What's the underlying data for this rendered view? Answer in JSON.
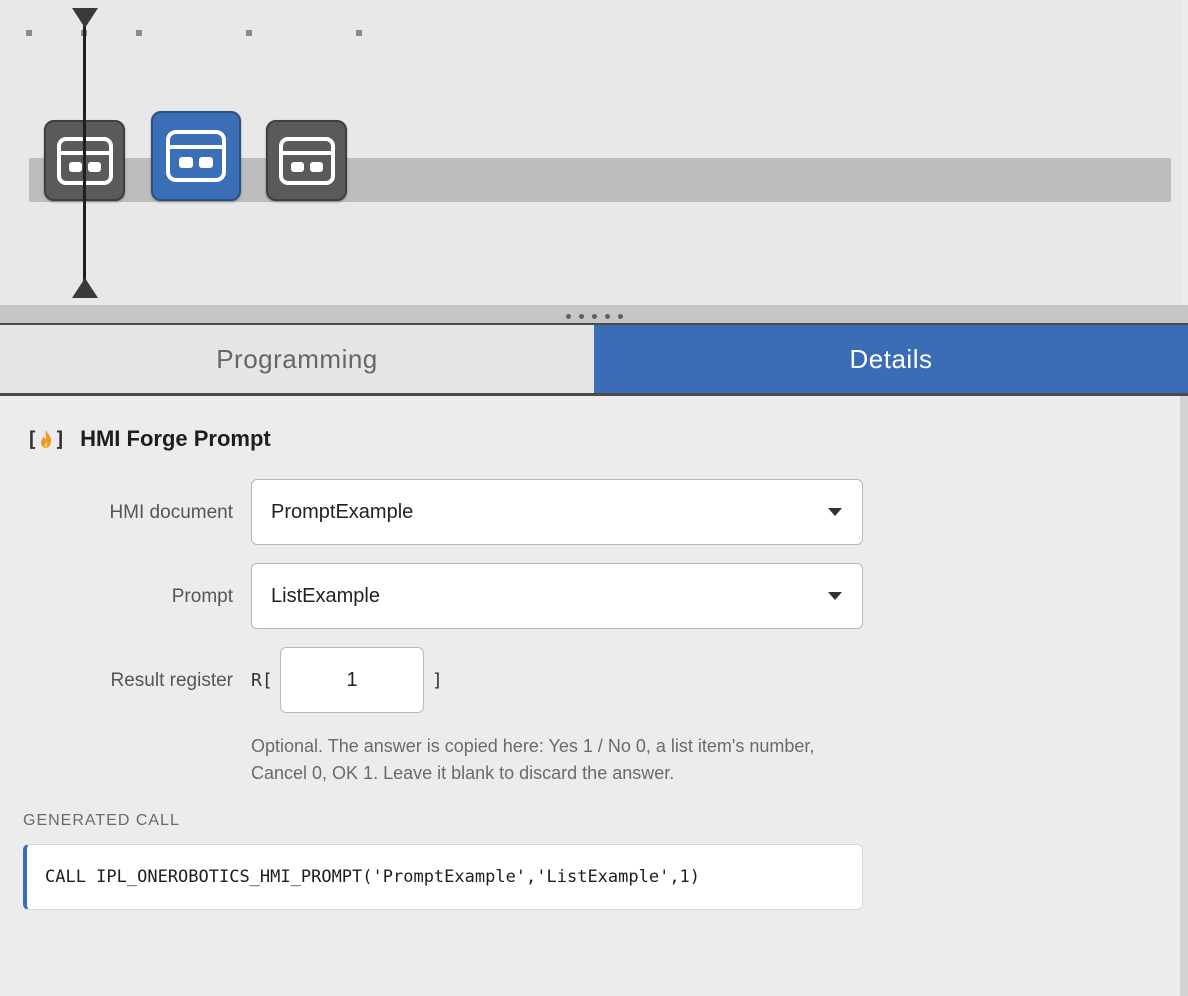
{
  "timeline": {
    "nodes": [
      {
        "icon": "card-icon",
        "state": "inactive"
      },
      {
        "icon": "card-icon",
        "state": "selected"
      },
      {
        "icon": "card-icon",
        "state": "inactive"
      }
    ]
  },
  "tabs": {
    "programming": "Programming",
    "details": "Details",
    "active": "details"
  },
  "details": {
    "header_icon": "flame-bracket-icon",
    "title": "HMI Forge Prompt",
    "fields": {
      "hmi_document": {
        "label": "HMI document",
        "value": "PromptExample"
      },
      "prompt": {
        "label": "Prompt",
        "value": "ListExample"
      },
      "result_register": {
        "label": "Result register",
        "prefix": "R[",
        "value": "1",
        "suffix": "]"
      }
    },
    "help_text": "Optional. The answer is copied here: Yes 1 / No 0, a list item's number, Cancel 0, OK 1. Leave it blank to discard the answer.",
    "generated_call_label": "GENERATED CALL",
    "generated_call": "CALL IPL_ONEROBOTICS_HMI_PROMPT('PromptExample','ListExample',1)"
  },
  "colors": {
    "accent": "#3b6cb6",
    "node_inactive": "#5a5a5a",
    "track": "#bdbdbd"
  }
}
